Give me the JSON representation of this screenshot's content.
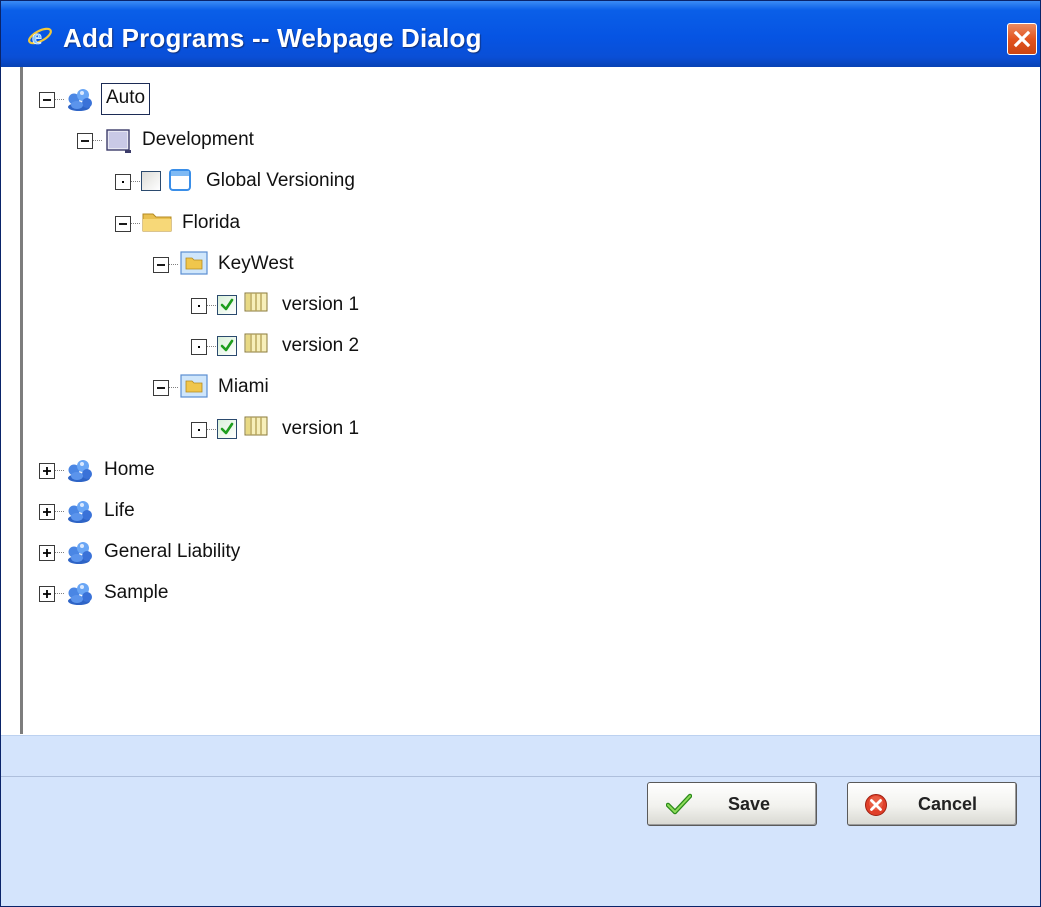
{
  "window": {
    "title": "Add Programs -- Webpage Dialog",
    "title_icon": "ie-icon",
    "close_icon": "close-icon"
  },
  "colors": {
    "titlebar": "#0654e3",
    "close_button": "#e3541f",
    "footer": "#d4e4fc",
    "selection_border": "#1c2b55",
    "check_green": "#1e9e1e"
  },
  "tree": {
    "nodes": [
      {
        "label": "Auto",
        "level": 0,
        "icon": "product-icon",
        "expander": "minus",
        "selected": true
      },
      {
        "label": "Development",
        "level": 1,
        "icon": "project-icon",
        "expander": "minus"
      },
      {
        "label": "Global Versioning",
        "level": 2,
        "icon": "window-icon",
        "expander": "dot",
        "checkbox": false
      },
      {
        "label": "Florida",
        "level": 2,
        "icon": "folder-icon",
        "expander": "minus"
      },
      {
        "label": "KeyWest",
        "level": 3,
        "icon": "program-folder-icon",
        "expander": "minus"
      },
      {
        "label": "version 1",
        "level": 4,
        "icon": "version-icon",
        "expander": "dot",
        "checkbox": true
      },
      {
        "label": "version 2",
        "level": 4,
        "icon": "version-icon",
        "expander": "dot",
        "checkbox": true
      },
      {
        "label": "Miami",
        "level": 3,
        "icon": "program-folder-icon",
        "expander": "minus"
      },
      {
        "label": "version 1",
        "level": 4,
        "icon": "version-icon",
        "expander": "dot",
        "checkbox": true
      },
      {
        "label": "Home",
        "level": 0,
        "icon": "product-icon",
        "expander": "plus"
      },
      {
        "label": "Life",
        "level": 0,
        "icon": "product-icon",
        "expander": "plus"
      },
      {
        "label": "General Liability",
        "level": 0,
        "icon": "product-icon",
        "expander": "plus"
      },
      {
        "label": "Sample",
        "level": 0,
        "icon": "product-icon",
        "expander": "plus"
      }
    ]
  },
  "buttons": {
    "save": {
      "label": "Save",
      "icon": "checkmark-icon"
    },
    "cancel": {
      "label": "Cancel",
      "icon": "cancel-icon"
    }
  }
}
